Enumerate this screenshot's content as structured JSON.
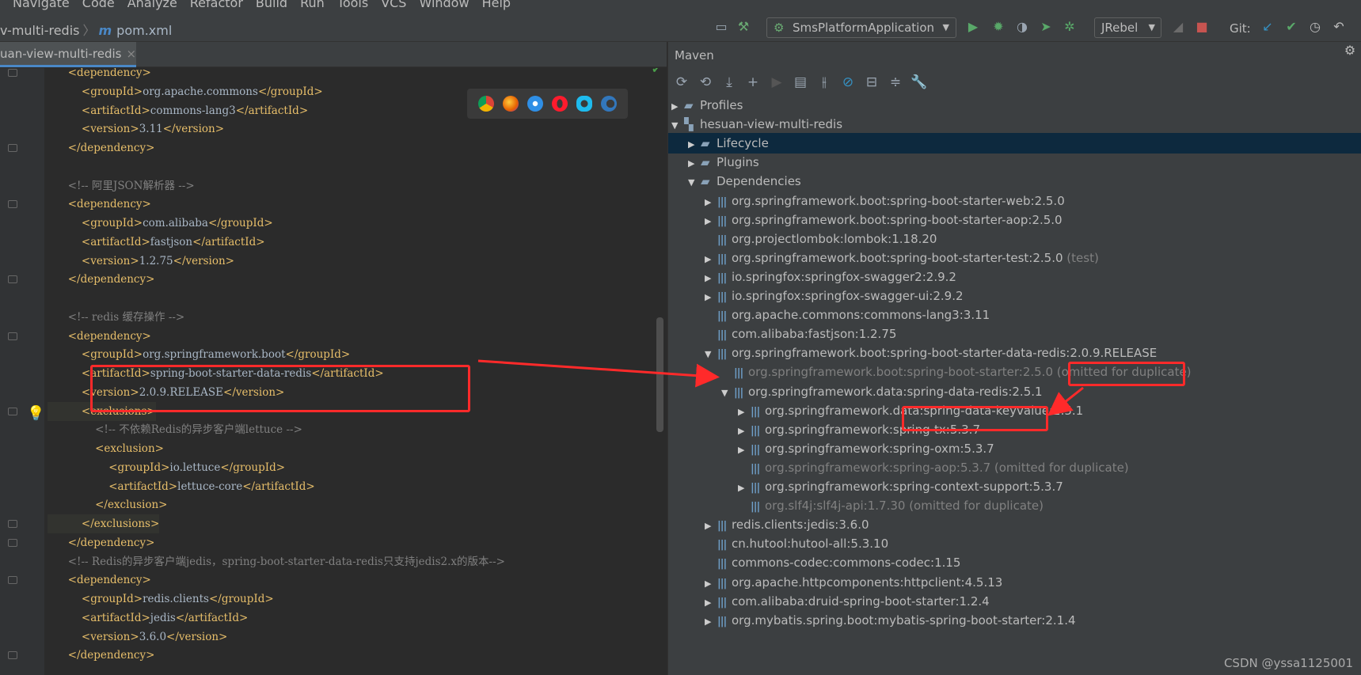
{
  "menu": [
    "Navigate",
    "Code",
    "Analyze",
    "Refactor",
    "Build",
    "Run",
    "Tools",
    "VCS",
    "Window",
    "Help"
  ],
  "breadcrumb": {
    "project": "v-multi-redis",
    "module_mark": "m",
    "file": "pom.xml"
  },
  "toolbar": {
    "run_config": "SmsPlatformApplication",
    "jrebel": "JRebel",
    "git_label": "Git:"
  },
  "editor": {
    "tab_label": "uan-view-multi-redis",
    "tab_close": "×",
    "lines": [
      {
        "indent": "      ",
        "html": "<span class='t'>&lt;dependency&gt;</span>"
      },
      {
        "indent": "          ",
        "text_parts": [
          [
            "t",
            "<groupId>"
          ],
          [
            "v",
            "org.apache.commons"
          ],
          [
            "t",
            "</groupId>"
          ]
        ]
      },
      {
        "indent": "          ",
        "text_parts": [
          [
            "t",
            "<artifactId>"
          ],
          [
            "v",
            "commons-lang3"
          ],
          [
            "t",
            "</artifactId>"
          ]
        ]
      },
      {
        "indent": "          ",
        "text_parts": [
          [
            "t",
            "<version>"
          ],
          [
            "v",
            "3.11"
          ],
          [
            "t",
            "</version>"
          ]
        ]
      },
      {
        "indent": "      ",
        "text_parts": [
          [
            "t",
            "</dependency>"
          ]
        ]
      },
      {
        "indent": "",
        "text_parts": [
          [
            "v",
            ""
          ]
        ]
      },
      {
        "indent": "      ",
        "text_parts": [
          [
            "c",
            "<!-- 阿里JSON解析器 -->"
          ]
        ]
      },
      {
        "indent": "      ",
        "text_parts": [
          [
            "t",
            "<dependency>"
          ]
        ]
      },
      {
        "indent": "          ",
        "text_parts": [
          [
            "t",
            "<groupId>"
          ],
          [
            "v",
            "com.alibaba"
          ],
          [
            "t",
            "</groupId>"
          ]
        ]
      },
      {
        "indent": "          ",
        "text_parts": [
          [
            "t",
            "<artifactId>"
          ],
          [
            "v",
            "fastjson"
          ],
          [
            "t",
            "</artifactId>"
          ]
        ]
      },
      {
        "indent": "          ",
        "text_parts": [
          [
            "t",
            "<version>"
          ],
          [
            "v",
            "1.2.75"
          ],
          [
            "t",
            "</version>"
          ]
        ]
      },
      {
        "indent": "      ",
        "text_parts": [
          [
            "t",
            "</dependency>"
          ]
        ]
      },
      {
        "indent": "",
        "text_parts": [
          [
            "v",
            ""
          ]
        ]
      },
      {
        "indent": "      ",
        "text_parts": [
          [
            "c",
            "<!-- redis 缓存操作 -->"
          ]
        ]
      },
      {
        "indent": "      ",
        "text_parts": [
          [
            "t",
            "<dependency>"
          ]
        ]
      },
      {
        "indent": "          ",
        "text_parts": [
          [
            "t",
            "<groupId>"
          ],
          [
            "v",
            "org.springframework.boot"
          ],
          [
            "t",
            "</groupId>"
          ]
        ]
      },
      {
        "indent": "          ",
        "text_parts": [
          [
            "t",
            "<artifactId>"
          ],
          [
            "v",
            "spring-boot-starter-data-redis"
          ],
          [
            "t",
            "</artifactId>"
          ]
        ]
      },
      {
        "indent": "          ",
        "text_parts": [
          [
            "t",
            "<version>"
          ],
          [
            "v",
            "2.0.9.RELEASE"
          ],
          [
            "t",
            "</version>"
          ]
        ]
      },
      {
        "indent": "          ",
        "text_parts": [
          [
            "t",
            "<exclusions>"
          ]
        ],
        "hl": true
      },
      {
        "indent": "              ",
        "text_parts": [
          [
            "c",
            "<!-- 不依赖Redis的异步客户端lettuce -->"
          ]
        ]
      },
      {
        "indent": "              ",
        "text_parts": [
          [
            "t",
            "<exclusion>"
          ]
        ]
      },
      {
        "indent": "                  ",
        "text_parts": [
          [
            "t",
            "<groupId>"
          ],
          [
            "v",
            "io.lettuce"
          ],
          [
            "t",
            "</groupId>"
          ]
        ]
      },
      {
        "indent": "                  ",
        "text_parts": [
          [
            "t",
            "<artifactId>"
          ],
          [
            "v",
            "lettuce-core"
          ],
          [
            "t",
            "</artifactId>"
          ]
        ]
      },
      {
        "indent": "              ",
        "text_parts": [
          [
            "t",
            "</exclusion>"
          ]
        ]
      },
      {
        "indent": "          ",
        "text_parts": [
          [
            "t",
            "</exclusions>"
          ]
        ],
        "hl": true
      },
      {
        "indent": "      ",
        "text_parts": [
          [
            "t",
            "</dependency>"
          ]
        ]
      },
      {
        "indent": "      ",
        "text_parts": [
          [
            "c",
            "<!-- Redis的异步客户端jedis，spring-boot-starter-data-redis只支持jedis2.x的版本-->"
          ]
        ]
      },
      {
        "indent": "      ",
        "text_parts": [
          [
            "t",
            "<dependency>"
          ]
        ]
      },
      {
        "indent": "          ",
        "text_parts": [
          [
            "t",
            "<groupId>"
          ],
          [
            "v",
            "redis.clients"
          ],
          [
            "t",
            "</groupId>"
          ]
        ]
      },
      {
        "indent": "          ",
        "text_parts": [
          [
            "t",
            "<artifactId>"
          ],
          [
            "v",
            "jedis"
          ],
          [
            "t",
            "</artifactId>"
          ]
        ]
      },
      {
        "indent": "          ",
        "text_parts": [
          [
            "t",
            "<version>"
          ],
          [
            "v",
            "3.6.0"
          ],
          [
            "t",
            "</version>"
          ]
        ]
      },
      {
        "indent": "      ",
        "text_parts": [
          [
            "t",
            "</dependency>"
          ]
        ]
      }
    ]
  },
  "maven": {
    "title": "Maven",
    "tree": [
      {
        "level": 0,
        "expander": "right",
        "icon": "folder",
        "label": "Profiles"
      },
      {
        "level": 0,
        "expander": "down",
        "icon": "module",
        "label": "hesuan-view-multi-redis"
      },
      {
        "level": 1,
        "expander": "right",
        "icon": "folder",
        "label": "Lifecycle",
        "selected": true
      },
      {
        "level": 1,
        "expander": "right",
        "icon": "folder",
        "label": "Plugins"
      },
      {
        "level": 1,
        "expander": "down",
        "icon": "folder",
        "label": "Dependencies"
      },
      {
        "level": 2,
        "expander": "right",
        "icon": "lib",
        "label": "org.springframework.boot:spring-boot-starter-web:2.5.0"
      },
      {
        "level": 2,
        "expander": "right",
        "icon": "lib",
        "label": "org.springframework.boot:spring-boot-starter-aop:2.5.0"
      },
      {
        "level": 2,
        "expander": "none",
        "icon": "lib",
        "label": "org.projectlombok:lombok:1.18.20"
      },
      {
        "level": 2,
        "expander": "right",
        "icon": "lib",
        "label": "org.springframework.boot:spring-boot-starter-test:2.5.0",
        "suffix": " (test)"
      },
      {
        "level": 2,
        "expander": "right",
        "icon": "lib",
        "label": "io.springfox:springfox-swagger2:2.9.2"
      },
      {
        "level": 2,
        "expander": "right",
        "icon": "lib",
        "label": "io.springfox:springfox-swagger-ui:2.9.2"
      },
      {
        "level": 2,
        "expander": "none",
        "icon": "lib",
        "label": "org.apache.commons:commons-lang3:3.11"
      },
      {
        "level": 2,
        "expander": "none",
        "icon": "lib",
        "label": "com.alibaba:fastjson:1.2.75"
      },
      {
        "level": 2,
        "expander": "down",
        "icon": "lib",
        "label": "org.springframework.boot:spring-boot-starter-data-redis:2.0.9.RELEASE"
      },
      {
        "level": 3,
        "expander": "none",
        "icon": "lib",
        "label": "org.springframework.boot:spring-boot-starter:2.5.0",
        "suffix": " (omitted for duplicate)",
        "dim": true
      },
      {
        "level": 3,
        "expander": "down",
        "icon": "lib",
        "label": "org.springframework.data:spring-data-redis:2.5.1"
      },
      {
        "level": 4,
        "expander": "right",
        "icon": "lib",
        "label": "org.springframework.data:spring-data-keyvalue:2.5.1"
      },
      {
        "level": 4,
        "expander": "right",
        "icon": "lib",
        "label": "org.springframework:spring-tx:5.3.7"
      },
      {
        "level": 4,
        "expander": "right",
        "icon": "lib",
        "label": "org.springframework:spring-oxm:5.3.7"
      },
      {
        "level": 4,
        "expander": "none",
        "icon": "lib",
        "label": "org.springframework:spring-aop:5.3.7",
        "suffix": " (omitted for duplicate)",
        "dim": true
      },
      {
        "level": 4,
        "expander": "right",
        "icon": "lib",
        "label": "org.springframework:spring-context-support:5.3.7"
      },
      {
        "level": 4,
        "expander": "none",
        "icon": "lib",
        "label": "org.slf4j:slf4j-api:1.7.30",
        "suffix": " (omitted for duplicate)",
        "dim": true
      },
      {
        "level": 2,
        "expander": "right",
        "icon": "lib",
        "label": "redis.clients:jedis:3.6.0"
      },
      {
        "level": 2,
        "expander": "none",
        "icon": "lib",
        "label": "cn.hutool:hutool-all:5.3.10"
      },
      {
        "level": 2,
        "expander": "none",
        "icon": "lib",
        "label": "commons-codec:commons-codec:1.15"
      },
      {
        "level": 2,
        "expander": "right",
        "icon": "lib",
        "label": "org.apache.httpcomponents:httpclient:4.5.13"
      },
      {
        "level": 2,
        "expander": "right",
        "icon": "lib",
        "label": "com.alibaba:druid-spring-boot-starter:1.2.4"
      },
      {
        "level": 2,
        "expander": "right",
        "icon": "lib",
        "label": "org.mybatis.spring.boot:mybatis-spring-boot-starter:2.1.4"
      }
    ]
  },
  "watermark": "CSDN @yssa1125001",
  "colors": {
    "annotation": "#ff2a2a",
    "selection": "#0d293e",
    "tag": "#e8bf6a",
    "comment": "#808080"
  }
}
